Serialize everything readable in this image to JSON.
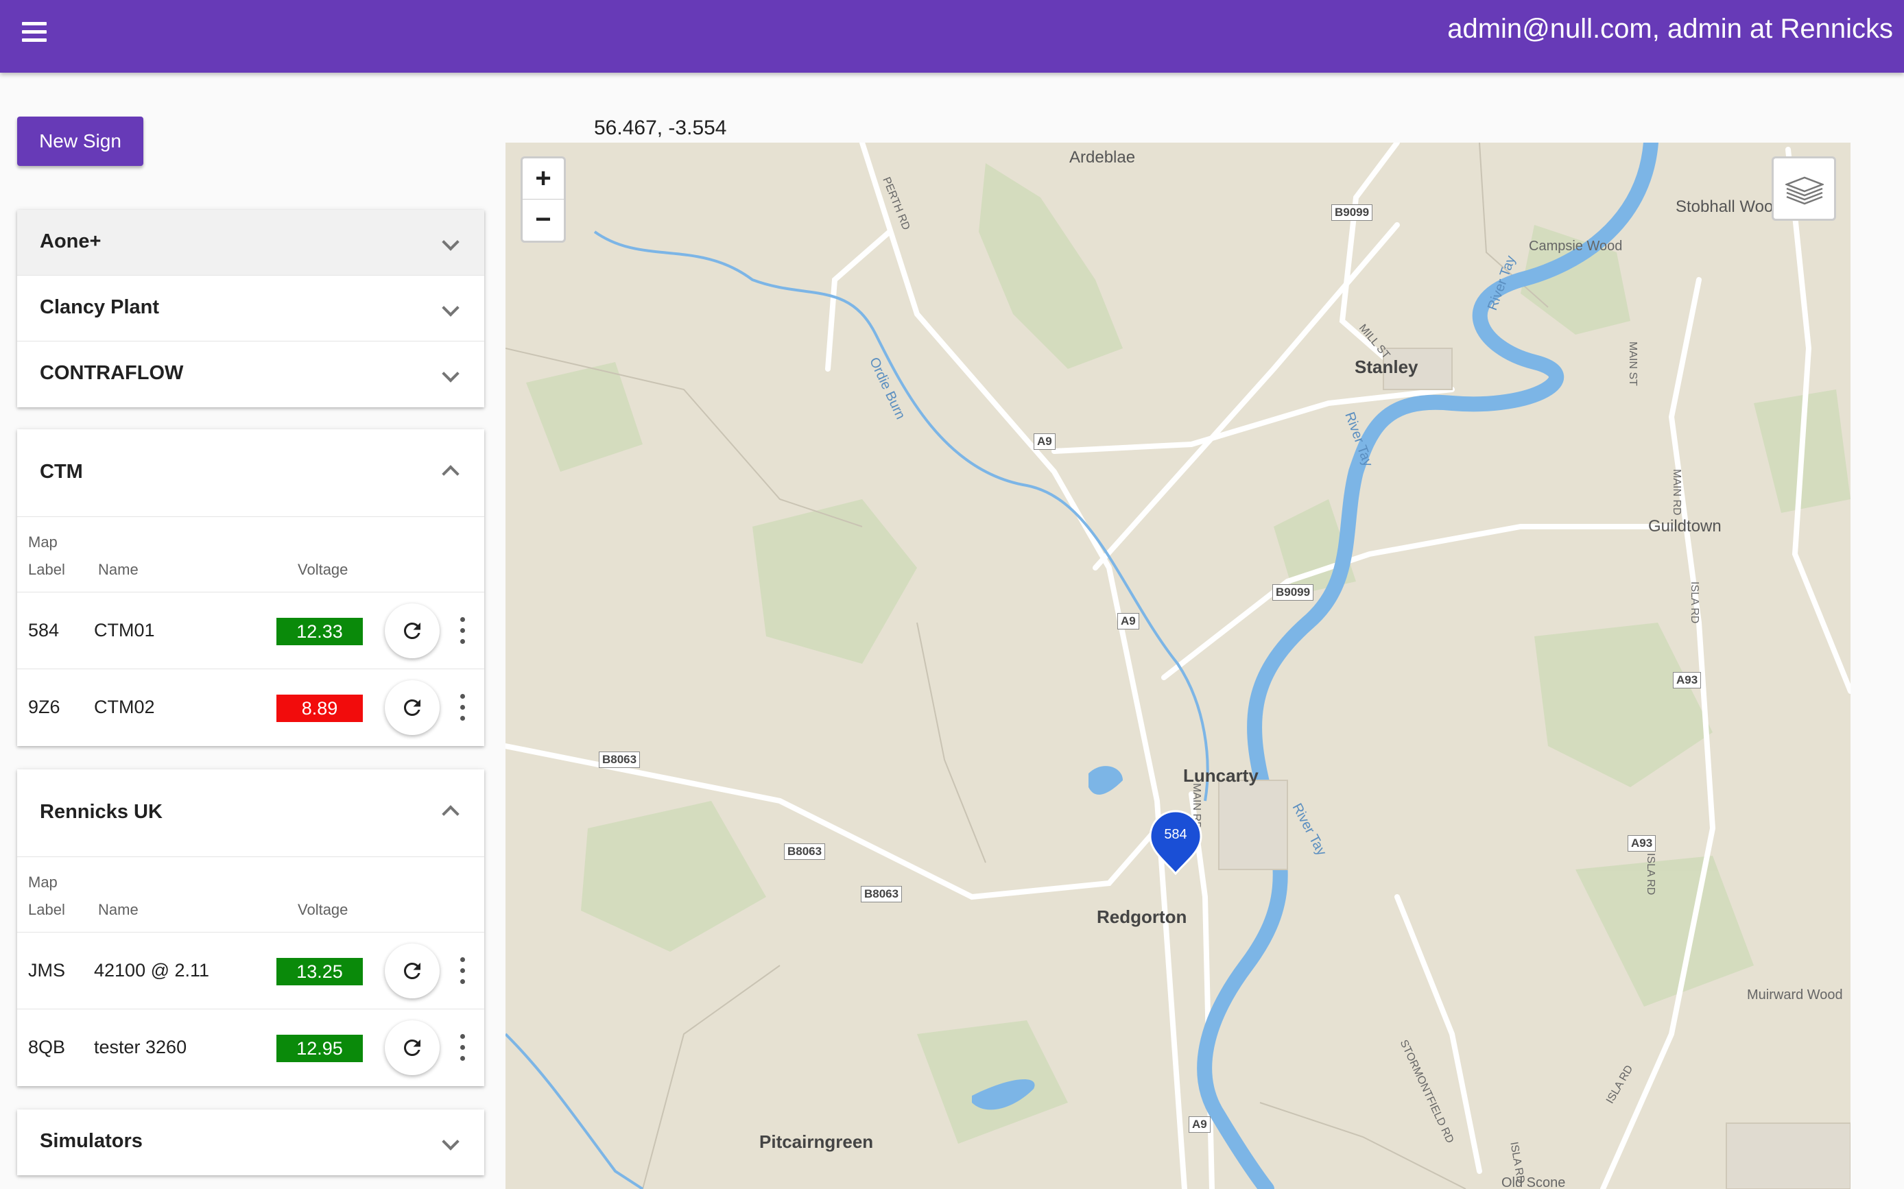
{
  "header": {
    "menu_icon": "hamburger-menu-icon",
    "user_text": "admin@null.com, admin at Rennicks"
  },
  "toolbar": {
    "new_sign_label": "New Sign"
  },
  "groups_collapsed_top": [
    {
      "title": "Aone+"
    },
    {
      "title": "Clancy Plant"
    },
    {
      "title": "CONTRAFLOW"
    }
  ],
  "table_headers": {
    "map": "Map",
    "label": "Label",
    "name": "Name",
    "voltage": "Voltage"
  },
  "ctm": {
    "title": "CTM",
    "rows": [
      {
        "label": "584",
        "name": "CTM01",
        "voltage": "12.33",
        "status_color": "#0a8a0a"
      },
      {
        "label": "9Z6",
        "name": "CTM02",
        "voltage": "8.89",
        "status_color": "#f20c0c"
      }
    ]
  },
  "rennicks": {
    "title": "Rennicks UK",
    "rows": [
      {
        "label": "JMS",
        "name": "42100 @ 2.11",
        "voltage": "13.25",
        "status_color": "#0a8a0a"
      },
      {
        "label": "8QB",
        "name": "tester 3260",
        "voltage": "12.95",
        "status_color": "#0a8a0a"
      }
    ]
  },
  "simulators": {
    "title": "Simulators"
  },
  "map": {
    "coordinates": "56.467, -3.554",
    "zoom_in": "+",
    "zoom_out": "−",
    "marker_label": "584",
    "marker_color": "#1a4fd6",
    "places": {
      "ardeblae": "Ardeblae",
      "stobhall": "Stobhall Wood",
      "campsie": "Campsie Wood",
      "stanley": "Stanley",
      "guildtown": "Guildtown",
      "luncarty": "Luncarty",
      "redgorton": "Redgorton",
      "pitcairngreen": "Pitcairngreen",
      "muirward": "Muirward Wood",
      "oldscone": "Old Scone",
      "river_tay_1": "River Tay",
      "river_tay_2": "River Tay",
      "river_tay_3": "River Tay",
      "ordie_burn": "Ordie Burn",
      "perth_rd": "PERTH RD",
      "mill_st": "MILL ST",
      "main_st": "MAIN ST",
      "main_rd": "MAIN RD",
      "isla_rd_1": "ISLA RD",
      "isla_rd_2": "ISLA RD",
      "isla_rd_3": "ISLA RD",
      "isla_rd_4": "ISLA RD",
      "stormontfield_rd": "STORMONTFIELD RD",
      "main_rd_luncarty": "MAIN RD"
    },
    "shields": {
      "b9099_a": "B9099",
      "b9099_b": "B9099",
      "a9_a": "A9",
      "a9_b": "A9",
      "a9_c": "A9",
      "a93_a": "A93",
      "a93_b": "A93",
      "b8063_a": "B8063",
      "b8063_b": "B8063",
      "b8063_c": "B8063"
    },
    "colors": {
      "land": "#e6e1d2",
      "woods": "#cfd8b9",
      "water": "#7cb5e6",
      "road": "#ffffff"
    }
  }
}
